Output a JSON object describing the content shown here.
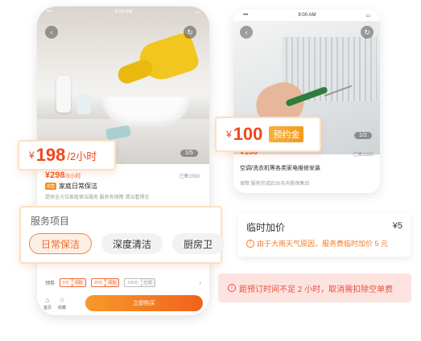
{
  "colors": {
    "accent": "#f0571f",
    "warning_bg": "#fde3e0",
    "deposit": "#f5a623"
  },
  "phone1": {
    "status_time": "9:00 AM",
    "gallery_counter": "1/5",
    "price": "¥298",
    "price_unit": "/3小时",
    "sold": "已售1560",
    "self_tag": "自营",
    "title": "家庭日常保洁",
    "subtitle": "提供全方位家庭保洁服务 服务有保障 清洁看得见",
    "coupon_label": "领券",
    "coupons": [
      {
        "amount": "5元",
        "action": "领取"
      },
      {
        "amount": "20元",
        "action": "领取"
      },
      {
        "amount": "100元",
        "action": "已领"
      }
    ],
    "tabs": [
      {
        "icon": "home-icon",
        "label": "首页"
      },
      {
        "icon": "star-icon",
        "label": "收藏"
      }
    ],
    "buy_label": "立即购买"
  },
  "phone2": {
    "status_time": "9:00 AM",
    "gallery_counter": "1/2",
    "price": "¥100",
    "sold": "已售1560",
    "title": "空调/洗衣机等各类家电维修安装",
    "subtitle": "保障    服务完成后30天内质保售后"
  },
  "callout_price1": {
    "currency": "¥",
    "amount": "198",
    "unit": "/2小时"
  },
  "callout_price2": {
    "currency": "¥",
    "amount": "100",
    "badge": "预约金"
  },
  "service": {
    "title": "服务项目",
    "items": [
      "日常保洁",
      "深度清洁",
      "厨房卫"
    ],
    "selected": 0
  },
  "temp_fee": {
    "label": "临时加价",
    "value": "¥5",
    "note": "由于大雨天气原因，服务费临时加价 5 元"
  },
  "warning": {
    "text": "距预订时间不足 2 小时，取消需扣除空单费"
  }
}
